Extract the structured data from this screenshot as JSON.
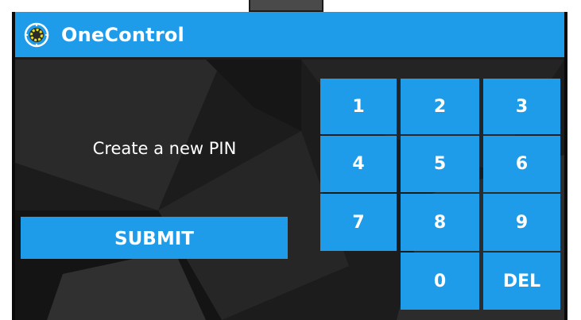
{
  "app": {
    "title": "OneControl",
    "logo_icon": "gear-target-icon",
    "accent_color": "#1f9ce9"
  },
  "pin": {
    "prompt": "Create a new PIN",
    "submit_label": "SUBMIT"
  },
  "keypad": {
    "keys": [
      "1",
      "2",
      "3",
      "4",
      "5",
      "6",
      "7",
      "8",
      "9",
      "",
      "0",
      "DEL"
    ]
  }
}
